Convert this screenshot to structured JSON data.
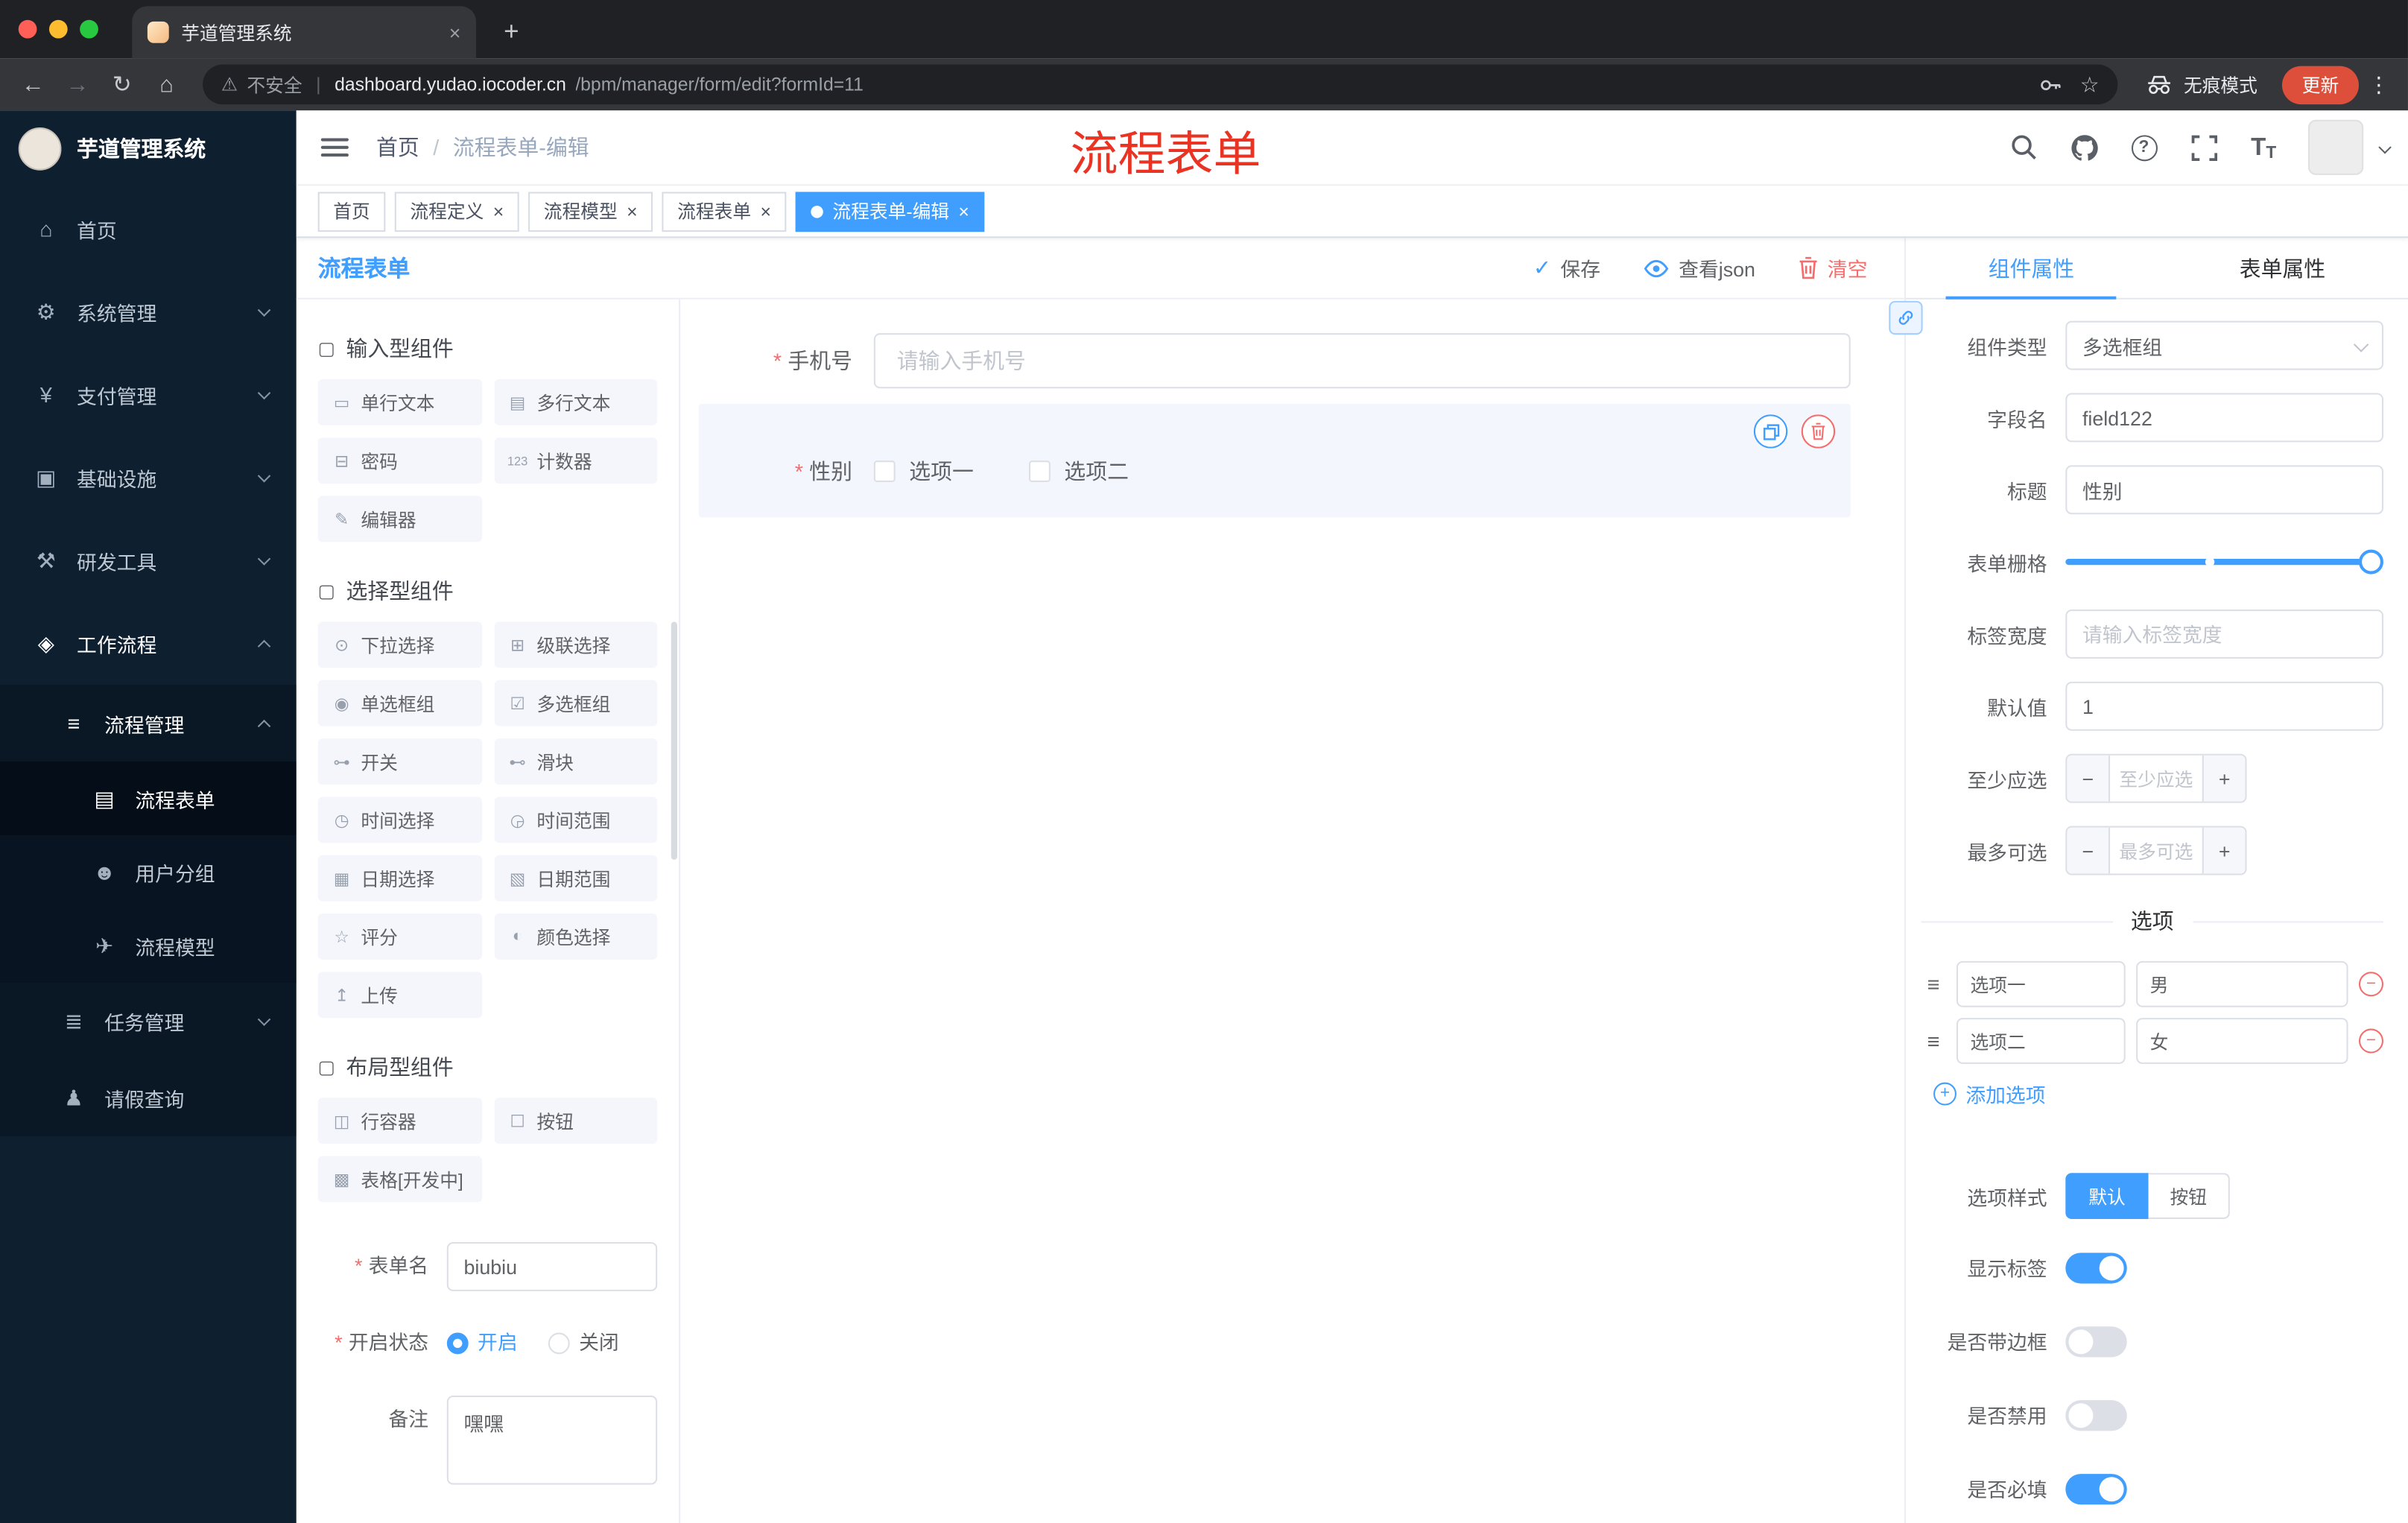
{
  "colors": {
    "accent": "#409eff",
    "danger": "#f56c6c",
    "sidebar_bg": "#0e1f30",
    "annotation_red": "#e93323",
    "update_button": "#dd4f3b",
    "tag_active": "#409eff"
  },
  "icons": {
    "home": "⌂",
    "system": "⚙",
    "payment": "¥",
    "infra": "▣",
    "devtools": "⚒",
    "workflow": "◈",
    "process-mgmt": "≡",
    "form": "▤",
    "user-group": "☻",
    "model": "✈",
    "task": "≣",
    "person": "♟",
    "group": "▢",
    "single-text": "▭",
    "multi-text": "▤",
    "password": "⊟",
    "counter": "123",
    "editor": "✎",
    "select": "⊙",
    "cascader": "⊞",
    "radio": "◉",
    "checkbox": "☑",
    "switch": "⊶",
    "slider": "⊷",
    "time": "◷",
    "time-range": "◶",
    "date": "▦",
    "date-range": "▧",
    "rate": "☆",
    "color": "◐",
    "upload": "↥",
    "row-container": "◫",
    "button": "☐",
    "table": "▩",
    "check": "✓",
    "back": "←",
    "forward": "→",
    "reload": "↻",
    "home-nav": "⌂",
    "warning": "⚠",
    "star": "☆",
    "plus": "+",
    "close": "×",
    "dots": "⋮",
    "minus": "−",
    "drag": "≡"
  },
  "browser": {
    "tab_title": "芋道管理系统",
    "security_label": "不安全",
    "url_host": "dashboard.yudao.iocoder.cn",
    "url_path": "/bpm/manager/form/edit?formId=11",
    "incognito_label": "无痕模式",
    "update_label": "更新"
  },
  "sidebar": {
    "app_title": "芋道管理系统",
    "items": [
      {
        "label": "首页"
      },
      {
        "label": "系统管理"
      },
      {
        "label": "支付管理"
      },
      {
        "label": "基础设施"
      },
      {
        "label": "研发工具"
      },
      {
        "label": "工作流程"
      },
      {
        "label": "流程管理"
      },
      {
        "label": "流程表单"
      },
      {
        "label": "用户分组"
      },
      {
        "label": "流程模型"
      },
      {
        "label": "任务管理"
      },
      {
        "label": "请假查询"
      }
    ]
  },
  "header": {
    "breadcrumb_root": "首页",
    "breadcrumb_current": "流程表单-编辑",
    "annotation": "流程表单"
  },
  "tags": [
    {
      "label": "首页",
      "closable": false,
      "active": false
    },
    {
      "label": "流程定义",
      "closable": true,
      "active": false
    },
    {
      "label": "流程模型",
      "closable": true,
      "active": false
    },
    {
      "label": "流程表单",
      "closable": true,
      "active": false
    },
    {
      "label": "流程表单-编辑",
      "closable": true,
      "active": true
    }
  ],
  "designer": {
    "title": "流程表单",
    "actions": {
      "save": "保存",
      "view_json": "查看json",
      "clear": "清空"
    },
    "palette": {
      "groups": [
        {
          "title": "输入型组件",
          "items": [
            "单行文本",
            "多行文本",
            "密码",
            "计数器",
            "编辑器"
          ]
        },
        {
          "title": "选择型组件",
          "items": [
            "下拉选择",
            "级联选择",
            "单选框组",
            "多选框组",
            "开关",
            "滑块",
            "时间选择",
            "时间范围",
            "日期选择",
            "日期范围",
            "评分",
            "颜色选择",
            "上传"
          ]
        },
        {
          "title": "布局型组件",
          "items": [
            "行容器",
            "按钮",
            "表格[开发中]"
          ]
        }
      ]
    },
    "meta": {
      "form_name_label": "表单名",
      "form_name_value": "biubiu",
      "status_label": "开启状态",
      "status_on": "开启",
      "status_off": "关闭",
      "remark_label": "备注",
      "remark_value": "嘿嘿"
    },
    "canvas": {
      "phone_label": "手机号",
      "phone_placeholder": "请输入手机号",
      "gender_label": "性别",
      "gender_option1": "选项一",
      "gender_option2": "选项二"
    }
  },
  "props": {
    "tab_component": "组件属性",
    "tab_form": "表单属性",
    "type_label": "组件类型",
    "type_value": "多选框组",
    "field_label": "字段名",
    "field_value": "field122",
    "title_label": "标题",
    "title_value": "性别",
    "grid_label": "表单栅格",
    "label_width_label": "标签宽度",
    "label_width_placeholder": "请输入标签宽度",
    "default_label": "默认值",
    "default_value": "1",
    "min_label": "至少应选",
    "min_placeholder": "至少应选",
    "max_label": "最多可选",
    "max_placeholder": "最多可选",
    "options_divider": "选项",
    "options": [
      {
        "label": "选项一",
        "value": "男"
      },
      {
        "label": "选项二",
        "value": "女"
      }
    ],
    "add_option": "添加选项",
    "style_label": "选项样式",
    "style_default": "默认",
    "style_button": "按钮",
    "switch_show_label": "显示标签",
    "switch_border": "是否带边框",
    "switch_disabled": "是否禁用",
    "switch_required": "是否必填",
    "switch_states": {
      "show_label": true,
      "border": false,
      "disabled": false,
      "required": true
    }
  }
}
